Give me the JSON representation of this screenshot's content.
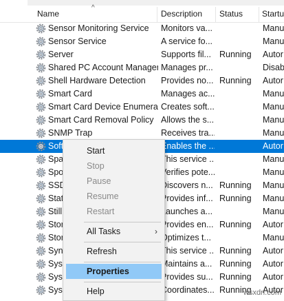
{
  "columns": {
    "name": "Name",
    "description": "Description",
    "status": "Status",
    "startup": "Startu"
  },
  "services": [
    {
      "name": "Sensor Monitoring Service",
      "description": "Monitors va...",
      "status": "",
      "startup": "Manu",
      "selected": false
    },
    {
      "name": "Sensor Service",
      "description": "A service fo...",
      "status": "",
      "startup": "Manu",
      "selected": false
    },
    {
      "name": "Server",
      "description": "Supports fil...",
      "status": "Running",
      "startup": "Autor",
      "selected": false
    },
    {
      "name": "Shared PC Account Manager",
      "description": "Manages pr...",
      "status": "",
      "startup": "Disab",
      "selected": false
    },
    {
      "name": "Shell Hardware Detection",
      "description": "Provides no...",
      "status": "Running",
      "startup": "Autor",
      "selected": false
    },
    {
      "name": "Smart Card",
      "description": "Manages ac...",
      "status": "",
      "startup": "Manu",
      "selected": false
    },
    {
      "name": "Smart Card Device Enumera...",
      "description": "Creates soft...",
      "status": "",
      "startup": "Manu",
      "selected": false
    },
    {
      "name": "Smart Card Removal Policy",
      "description": "Allows the s...",
      "status": "",
      "startup": "Manu",
      "selected": false
    },
    {
      "name": "SNMP Trap",
      "description": "Receives tra...",
      "status": "",
      "startup": "Manu",
      "selected": false
    },
    {
      "name": "Soft",
      "description": "Enables the ...",
      "status": "",
      "startup": "Autor",
      "selected": true
    },
    {
      "name": "Spat",
      "description": "This service ...",
      "status": "",
      "startup": "Manu",
      "selected": false
    },
    {
      "name": "Spot",
      "description": "Verifies pote...",
      "status": "",
      "startup": "Manu",
      "selected": false
    },
    {
      "name": "SSD",
      "description": "Discovers n...",
      "status": "Running",
      "startup": "Manu",
      "selected": false
    },
    {
      "name": "Stat",
      "description": "Provides inf...",
      "status": "Running",
      "startup": "Manu",
      "selected": false
    },
    {
      "name": "Still",
      "description": "Launches a...",
      "status": "",
      "startup": "Manu",
      "selected": false
    },
    {
      "name": "Stor",
      "description": "Provides en...",
      "status": "Running",
      "startup": "Autor",
      "selected": false
    },
    {
      "name": "Stor",
      "description": "Optimizes t...",
      "status": "",
      "startup": "Manu",
      "selected": false
    },
    {
      "name": "Sync",
      "description": "This service ...",
      "status": "Running",
      "startup": "Autor",
      "selected": false
    },
    {
      "name": "SysM",
      "description": "Maintains a...",
      "status": "Running",
      "startup": "Autor",
      "selected": false
    },
    {
      "name": "Syst",
      "description": "Provides su...",
      "status": "Running",
      "startup": "Autor",
      "selected": false
    },
    {
      "name": "Syst",
      "description": "Coordinates...",
      "status": "Running",
      "startup": "Autor",
      "selected": false
    }
  ],
  "context_menu": {
    "items": [
      {
        "label": "Start",
        "disabled": false
      },
      {
        "label": "Stop",
        "disabled": true
      },
      {
        "label": "Pause",
        "disabled": true
      },
      {
        "label": "Resume",
        "disabled": true
      },
      {
        "label": "Restart",
        "disabled": true
      },
      {
        "label": "All Tasks",
        "disabled": false,
        "submenu": true
      },
      {
        "label": "Refresh",
        "disabled": false
      },
      {
        "label": "Properties",
        "disabled": false,
        "bold": true,
        "highlighted": true
      },
      {
        "label": "Help",
        "disabled": false
      }
    ]
  },
  "watermark": "wsxdn.com"
}
